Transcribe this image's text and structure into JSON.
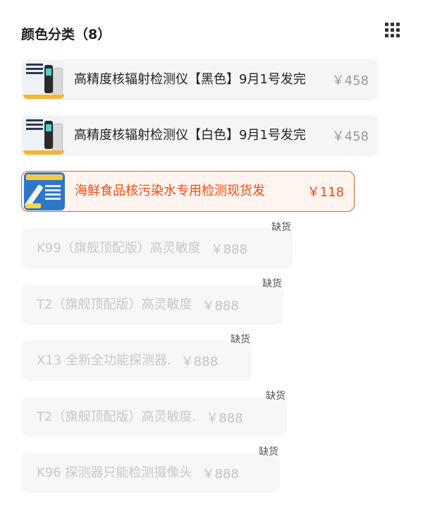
{
  "header": {
    "title": "颜色分类（8）"
  },
  "icons": {
    "grid": "grid-menu-icon"
  },
  "options": [
    {
      "name": "高精度核辐射检测仪【黑色】9月1号发完",
      "price": "￥458",
      "thumb": "black-detector-thumbnail"
    },
    {
      "name": "高精度核辐射检测仪【白色】9月1号发完",
      "price": "￥458",
      "thumb": "white-detector-thumbnail"
    },
    {
      "name": "海鲜食品核污染水专用检测现货发",
      "price": "￥118",
      "thumb": "seafood-pen-tester-thumbnail"
    },
    {
      "name": "K99（旗舰顶配版）高灵敏度",
      "price": "￥888"
    },
    {
      "name": "T2（旗舰顶配版）高灵敏度",
      "price": "￥888"
    },
    {
      "name": "X13 全新全功能探测器.",
      "price": "￥888"
    },
    {
      "name": "T2（旗舰顶配版）高灵敏度.",
      "price": "￥888"
    },
    {
      "name": "K96 探测器只能检测摄像头",
      "price": "￥888"
    }
  ],
  "out_of_stock_label": "缺货",
  "colors": {
    "accent": "#ef4d11",
    "selected_bg": "#fff4ef",
    "option_bg": "#f5f5f5",
    "disabled_text": "#c9c9c9"
  }
}
